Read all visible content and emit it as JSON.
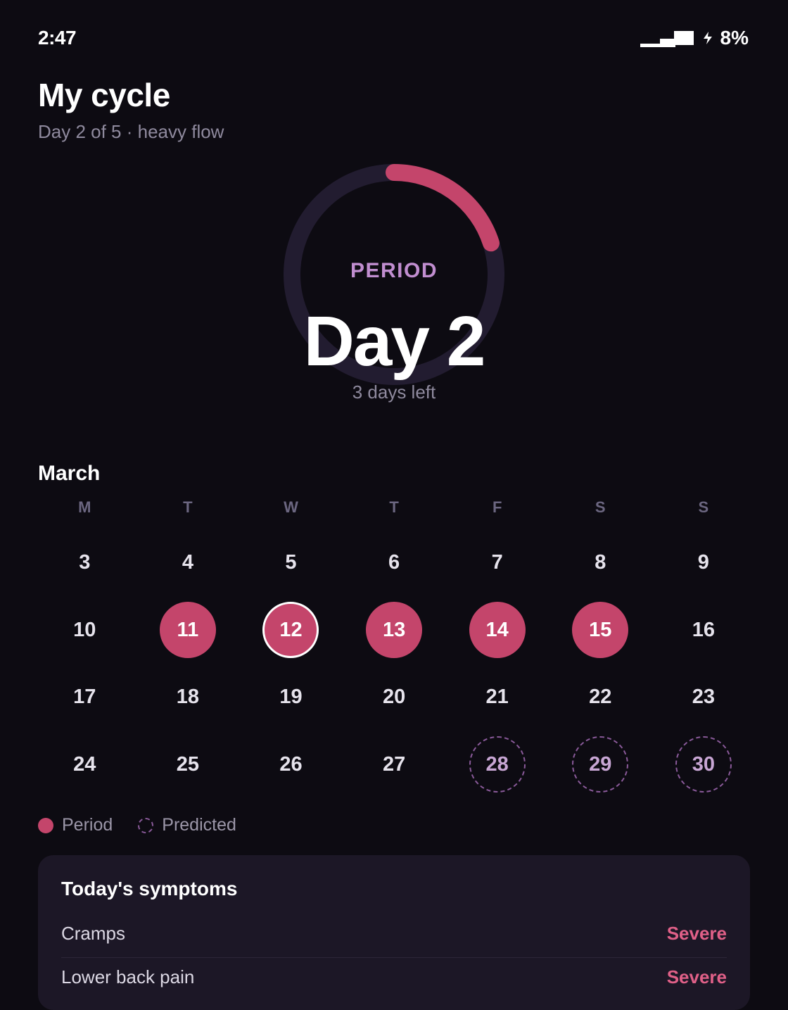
{
  "status": {
    "time": "2:47",
    "battery": "8%"
  },
  "header": {
    "title": "My cycle",
    "subtitle": "Day 2 of 5 · heavy flow"
  },
  "ring": {
    "label": "PERIOD",
    "day": "Day 2",
    "sub": "3 days left",
    "progress_fraction": 0.2
  },
  "calendar": {
    "month": "March",
    "weekdays": [
      "M",
      "T",
      "W",
      "T",
      "F",
      "S",
      "S"
    ],
    "weeks": [
      [
        {
          "d": "3"
        },
        {
          "d": "4"
        },
        {
          "d": "5"
        },
        {
          "d": "6"
        },
        {
          "d": "7"
        },
        {
          "d": "8"
        },
        {
          "d": "9"
        }
      ],
      [
        {
          "d": "10"
        },
        {
          "d": "11",
          "state": "period"
        },
        {
          "d": "12",
          "state": "period",
          "today": true
        },
        {
          "d": "13",
          "state": "period"
        },
        {
          "d": "14",
          "state": "period"
        },
        {
          "d": "15",
          "state": "period"
        },
        {
          "d": "16"
        }
      ],
      [
        {
          "d": "17"
        },
        {
          "d": "18"
        },
        {
          "d": "19"
        },
        {
          "d": "20"
        },
        {
          "d": "21"
        },
        {
          "d": "22"
        },
        {
          "d": "23"
        }
      ],
      [
        {
          "d": "24"
        },
        {
          "d": "25"
        },
        {
          "d": "26"
        },
        {
          "d": "27"
        },
        {
          "d": "28",
          "state": "predicted"
        },
        {
          "d": "29",
          "state": "predicted"
        },
        {
          "d": "30",
          "state": "predicted"
        }
      ]
    ]
  },
  "legend": {
    "period": "Period",
    "predicted": "Predicted"
  },
  "symptoms": {
    "title": "Today's symptoms",
    "items": [
      {
        "name": "Cramps",
        "severity": "Severe"
      },
      {
        "name": "Lower back pain",
        "severity": "Severe"
      }
    ]
  },
  "colors": {
    "accent": "#c4456b",
    "ring_track": "#221c30",
    "label": "#c18ed0",
    "predicted": "#8a5a9a"
  }
}
